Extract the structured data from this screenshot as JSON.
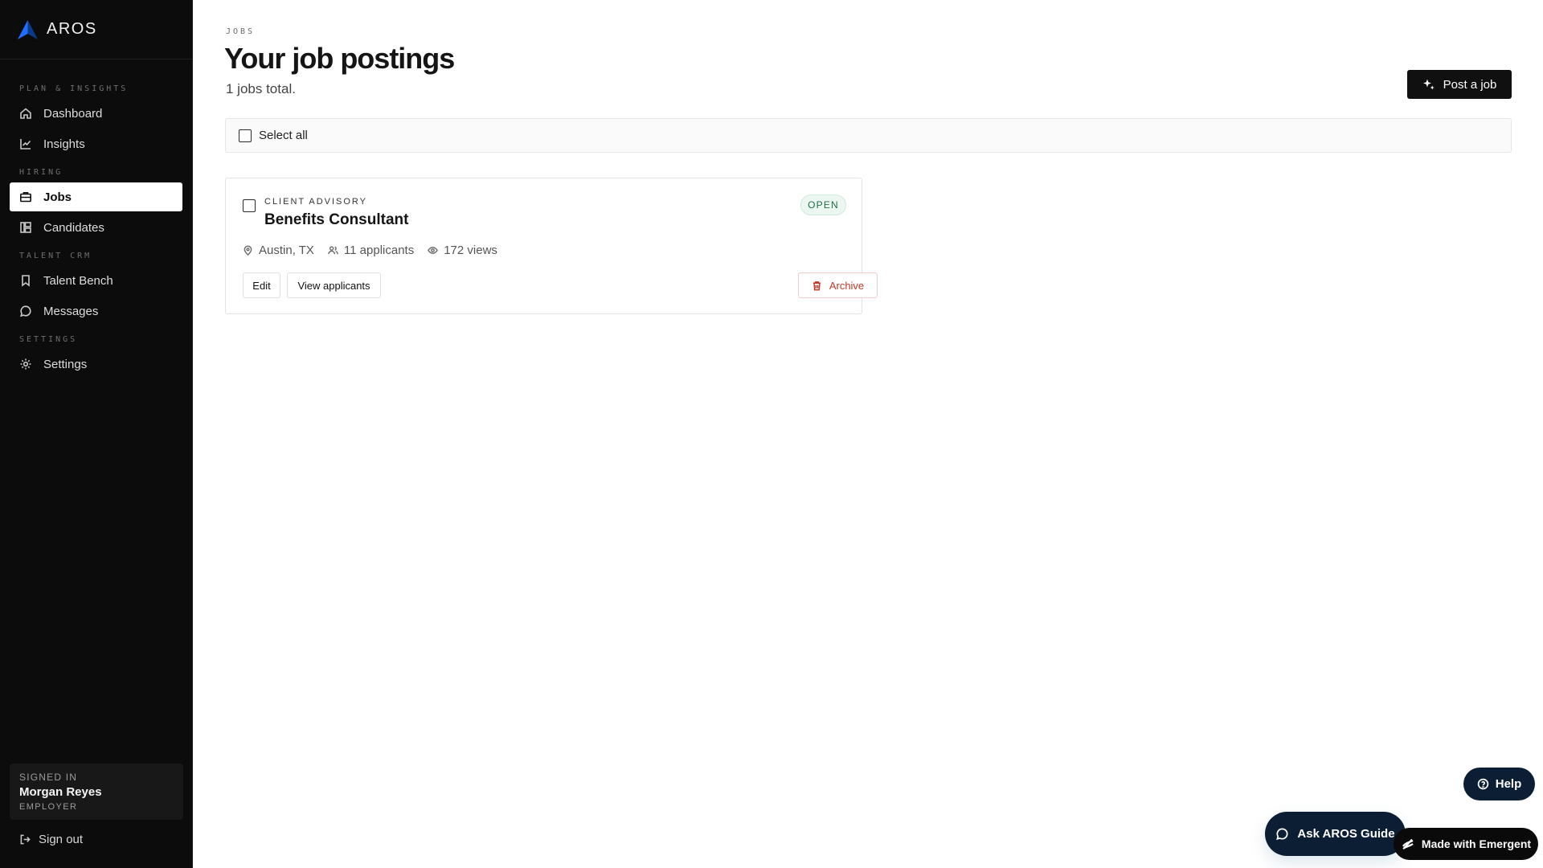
{
  "brand": {
    "name": "AROS",
    "logo_colors": [
      "#1e6fff",
      "#0b3a8a"
    ]
  },
  "sidebar": {
    "sections": [
      {
        "label": "PLAN & INSIGHTS",
        "items": [
          {
            "label": "Dashboard",
            "icon": "home-icon"
          },
          {
            "label": "Insights",
            "icon": "chart-line-icon"
          }
        ]
      },
      {
        "label": "HIRING",
        "items": [
          {
            "label": "Jobs",
            "icon": "briefcase-icon",
            "active": true
          },
          {
            "label": "Candidates",
            "icon": "kanban-icon"
          }
        ]
      },
      {
        "label": "TALENT CRM",
        "items": [
          {
            "label": "Talent Bench",
            "icon": "bookmark-icon"
          },
          {
            "label": "Messages",
            "icon": "message-circle-icon"
          }
        ]
      },
      {
        "label": "SETTINGS",
        "items": [
          {
            "label": "Settings",
            "icon": "gear-icon"
          }
        ]
      }
    ],
    "user": {
      "status": "SIGNED IN",
      "name": "Morgan Reyes",
      "role": "EMPLOYER"
    },
    "signout_label": "Sign out"
  },
  "header": {
    "eyebrow": "JOBS",
    "title": "Your job postings",
    "subtitle": "1 jobs total.",
    "post_button": "Post a job"
  },
  "select_all_label": "Select all",
  "jobs": [
    {
      "department": "CLIENT ADVISORY",
      "title": "Benefits Consultant",
      "status": "OPEN",
      "location": "Austin, TX",
      "applicants": "11 applicants",
      "views": "172 views",
      "actions": {
        "edit": "Edit",
        "view": "View applicants",
        "archive": "Archive"
      }
    }
  ],
  "floating": {
    "help": "Help",
    "guide": "Ask AROS Guide",
    "emergent": "Made with Emergent"
  },
  "colors": {
    "sidebar_bg": "#0c0c0c",
    "accent_dark": "#0b1e33",
    "status_open": "#1f6e45",
    "danger": "#c0392b"
  }
}
